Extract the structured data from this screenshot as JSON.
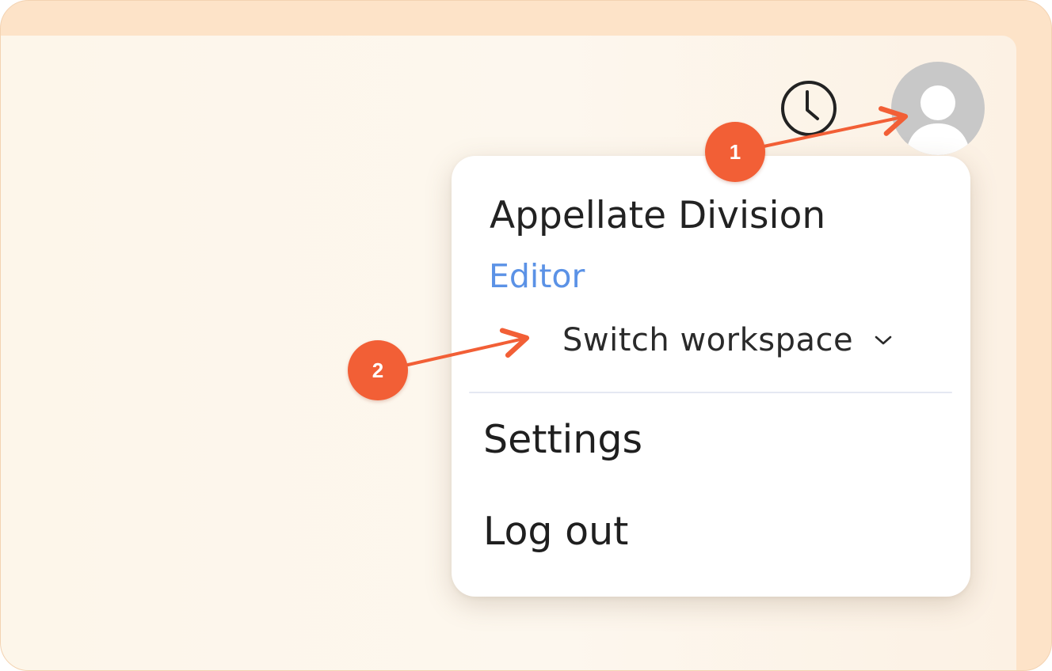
{
  "header": {
    "history_icon": "clock-icon",
    "avatar_icon": "user-avatar-icon"
  },
  "menu": {
    "workspace_name": "Appellate Division",
    "role": "Editor",
    "switch_workspace_label": "Switch workspace",
    "switch_workspace_icon": "chevron-down-icon",
    "items": [
      {
        "label": "Settings"
      },
      {
        "label": "Log out"
      }
    ]
  },
  "annotations": {
    "steps": [
      {
        "label": "1"
      },
      {
        "label": "2"
      }
    ]
  },
  "colors": {
    "accent": "#f25f36",
    "role_text": "#5b92e6",
    "frame": "#fde3c8",
    "panel": "#fdf6ea"
  }
}
